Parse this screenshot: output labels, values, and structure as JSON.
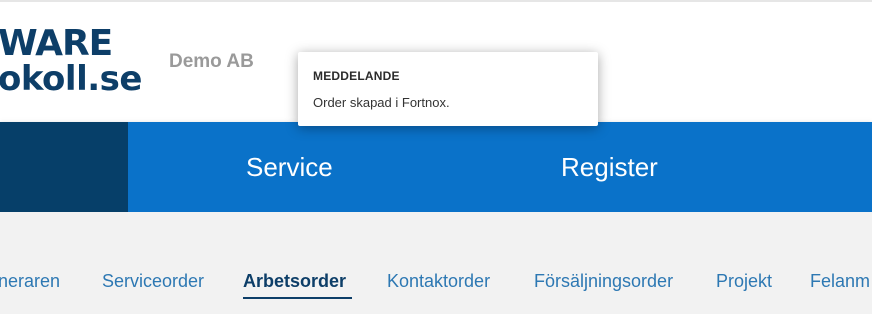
{
  "header": {
    "logo": {
      "line1": "WARE",
      "line2": "okoll.se"
    },
    "company_name": "Demo AB"
  },
  "colors": {
    "brand_dark": "#0d3e68",
    "nav_blue": "#0a72c9",
    "nav_dark": "#063f69",
    "link_blue": "#2d78b3"
  },
  "main_nav": {
    "items": [
      {
        "label": "Service"
      },
      {
        "label": "Register"
      }
    ]
  },
  "sub_nav": {
    "items": [
      {
        "label": "neraren",
        "active": false
      },
      {
        "label": "Serviceorder",
        "active": false
      },
      {
        "label": "Arbetsorder",
        "active": true
      },
      {
        "label": "Kontaktorder",
        "active": false
      },
      {
        "label": "Försäljningsorder",
        "active": false
      },
      {
        "label": "Projekt",
        "active": false
      },
      {
        "label": "Felanm",
        "active": false
      }
    ]
  },
  "notification": {
    "title": "MEDDELANDE",
    "message": "Order skapad i Fortnox."
  }
}
